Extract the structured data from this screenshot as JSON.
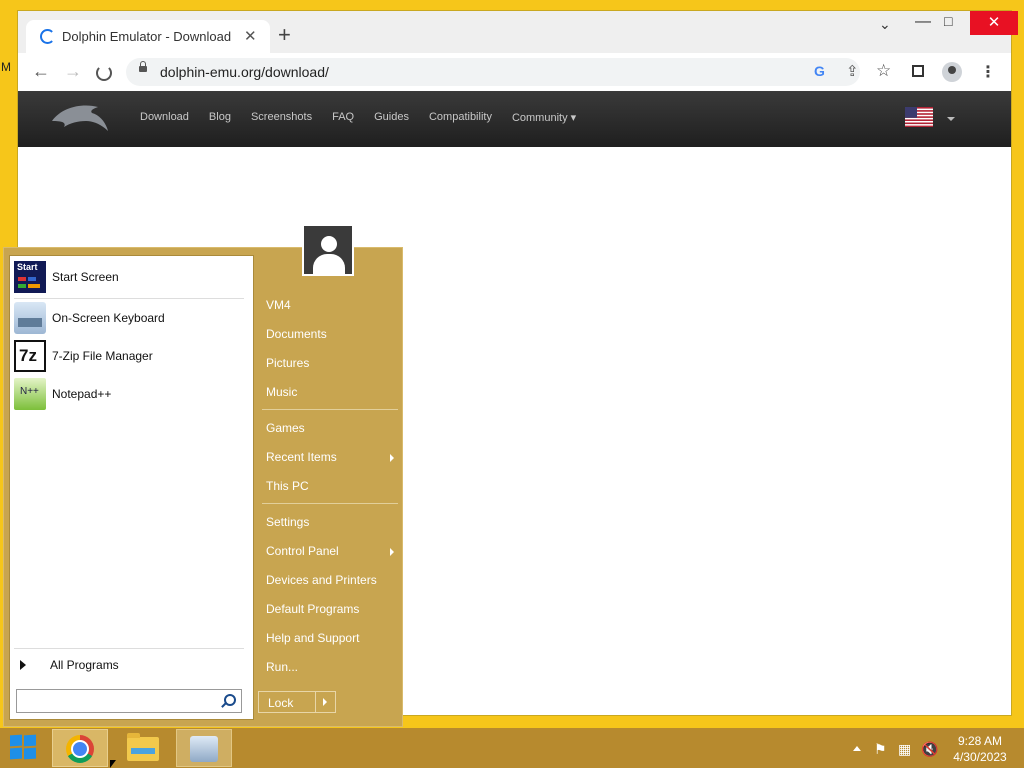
{
  "desktop": {
    "edge_text": "M"
  },
  "browser": {
    "tab_title": "Dolphin Emulator - Download",
    "tab_close": "✕",
    "new_tab": "+",
    "tab_list": "⌄",
    "window_min": "—",
    "window_max": "□",
    "window_close": "✕",
    "back": "←",
    "forward": "→",
    "url": "dolphin-emu.org/download/",
    "google_icon": "G",
    "share_icon": "⇪",
    "star_icon": "☆",
    "menu_icon": "⋮"
  },
  "site": {
    "nav": [
      "Download",
      "Blog",
      "Screenshots",
      "FAQ",
      "Guides",
      "Compatibility",
      "Community ▾"
    ]
  },
  "start_menu": {
    "pinned": [
      {
        "label": "Start Screen",
        "icon": "start-screen-icon"
      },
      {
        "label": "On-Screen Keyboard",
        "icon": "keyboard-icon"
      },
      {
        "label": "7-Zip File Manager",
        "icon": "7zip-icon"
      },
      {
        "label": "Notepad++",
        "icon": "notepadpp-icon"
      }
    ],
    "start_icon_text": "Start",
    "sevenzip_icon_text": "7z",
    "npp_icon_text": "N++",
    "all_programs": "All Programs",
    "search_placeholder": "",
    "right": {
      "vm4": "VM4",
      "documents": "Documents",
      "pictures": "Pictures",
      "music": "Music",
      "games": "Games",
      "recent_items": "Recent Items",
      "this_pc": "This PC",
      "settings": "Settings",
      "control_panel": "Control Panel",
      "devices_printers": "Devices and Printers",
      "default_programs": "Default Programs",
      "help_support": "Help and Support",
      "run": "Run..."
    },
    "lock": "Lock"
  },
  "tray": {
    "flag_icon": "⚑",
    "network_icon": "▦",
    "volume_icon": "🔇",
    "time": "9:28 AM",
    "date": "4/30/2023"
  }
}
